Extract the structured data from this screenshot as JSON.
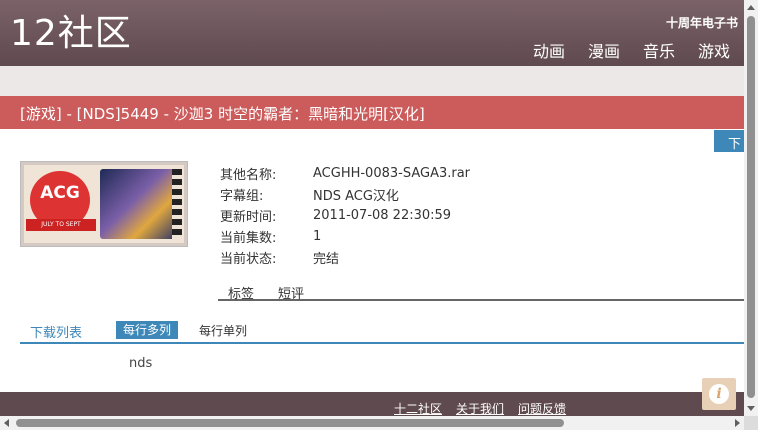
{
  "header": {
    "logo": "12社区",
    "tagline": "十周年电子书",
    "nav": [
      "动画",
      "漫画",
      "音乐",
      "游戏"
    ]
  },
  "title": "[游戏] - [NDS]5449 - 沙迦3 时空的霸者：黑暗和光明[汉化]",
  "download_button": "下载",
  "cover": {
    "badge": "ACG",
    "ribbon": "JULY TO SEPT"
  },
  "info": [
    {
      "label": "其他名称:",
      "value": "ACGHH-0083-SAGA3.rar"
    },
    {
      "label": "字幕组:",
      "value": "NDS ACG汉化"
    },
    {
      "label": "更新时间:",
      "value": "2011-07-08 22:30:59"
    },
    {
      "label": "当前集数:",
      "value": "1"
    },
    {
      "label": "当前状态:",
      "value": "完结"
    }
  ],
  "tabs": [
    "标签",
    "短评"
  ],
  "download_list": {
    "title": "下载列表",
    "mode_active": "每行多列",
    "mode_other": "每行单列",
    "platform": "nds"
  },
  "footer": {
    "links": [
      "十二社区",
      "关于我们",
      "问题反馈"
    ]
  },
  "colors": {
    "header": "#6b555b",
    "title_bar": "#cc5b5b",
    "accent": "#3d87b9"
  }
}
